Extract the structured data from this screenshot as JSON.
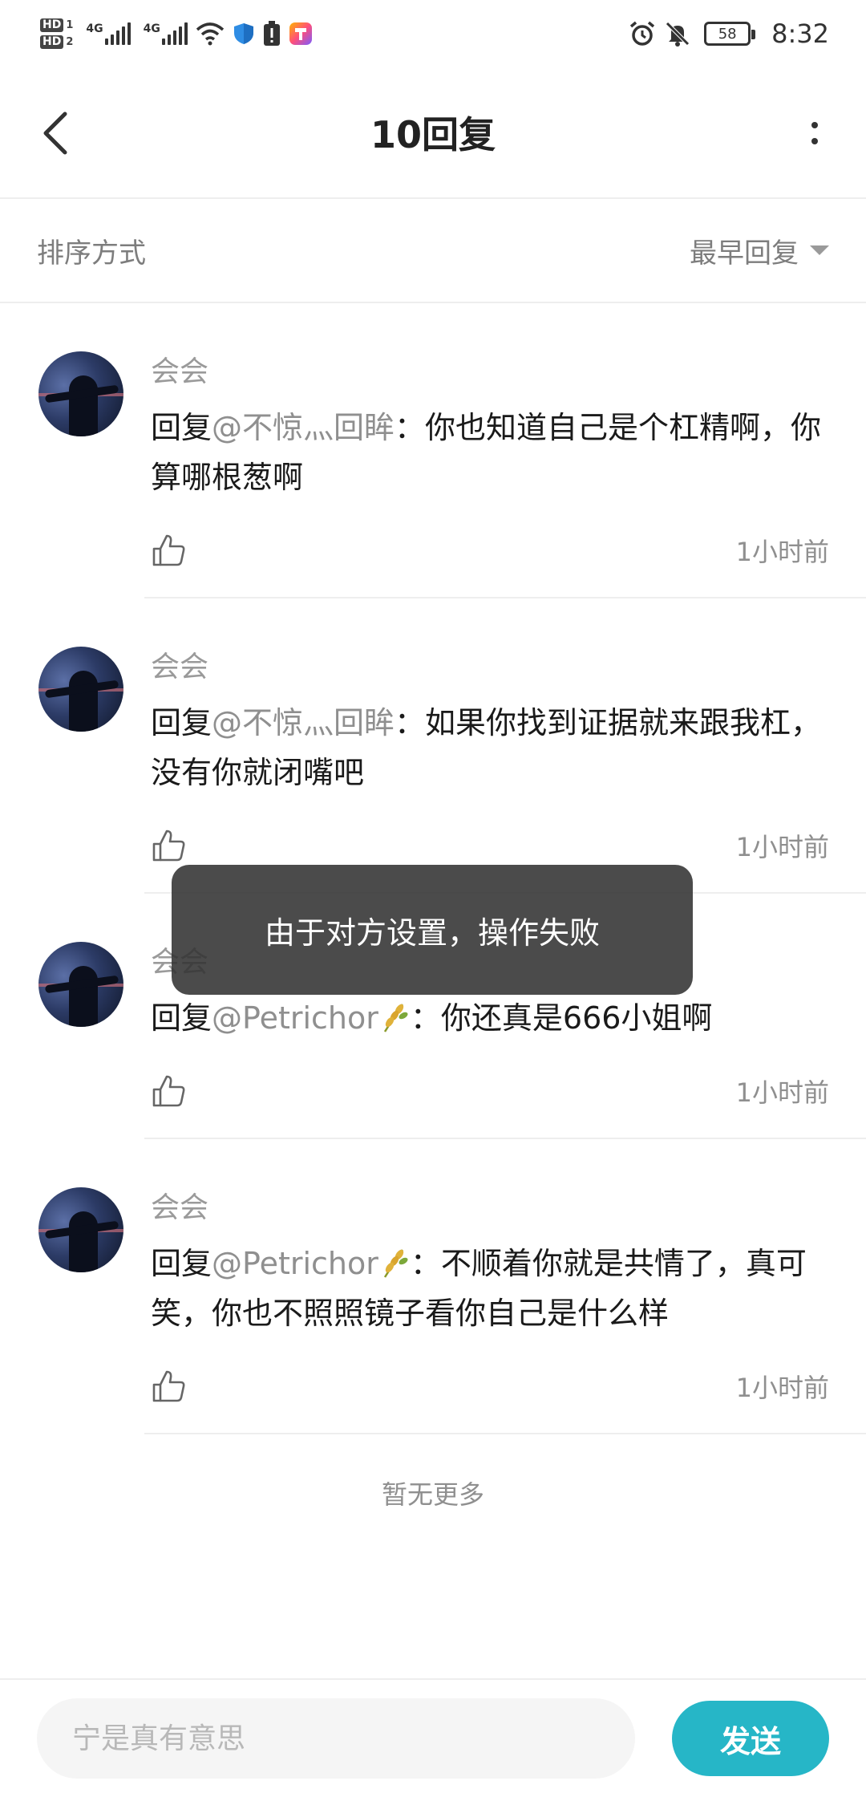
{
  "status_bar": {
    "sim1_tag": "HD",
    "sim1_num": "1",
    "sim2_tag": "HD",
    "sim2_num": "2",
    "network1": "4G",
    "network2": "4G",
    "battery": "58",
    "time": "8:32",
    "icons": [
      "signal-icon",
      "wifi-icon",
      "shield-icon",
      "alert-icon",
      "app-icon",
      "alarm-icon",
      "mute-icon"
    ]
  },
  "header": {
    "title": "10回复"
  },
  "sort": {
    "label": "排序方式",
    "value": "最早回复"
  },
  "replies": [
    {
      "username": "会会",
      "prefix": "回复",
      "mention": "@不惊灬回眸",
      "has_grain": false,
      "separator": "：",
      "text": "你也知道自己是个杠精啊，你算哪根葱啊",
      "time": "1小时前"
    },
    {
      "username": "会会",
      "prefix": "回复",
      "mention": "@不惊灬回眸",
      "has_grain": false,
      "separator": "：",
      "text": "如果你找到证据就来跟我杠，没有你就闭嘴吧",
      "time": "1小时前"
    },
    {
      "username": "会会",
      "prefix": "回复",
      "mention": "@Petrichor",
      "has_grain": true,
      "separator": "：",
      "text": "你还真是666小姐啊",
      "time": "1小时前"
    },
    {
      "username": "会会",
      "prefix": "回复",
      "mention": "@Petrichor",
      "has_grain": true,
      "separator": "：",
      "text": "不顺着你就是共情了，真可笑，你也不照照镜子看你自己是什么样",
      "time": "1小时前"
    }
  ],
  "footer_note": "暂无更多",
  "toast": "由于对方设置，操作失败",
  "input": {
    "placeholder": "宁是真有意思",
    "send_label": "发送"
  },
  "colors": {
    "accent": "#26b6c7",
    "muted_text": "#8f8f8f",
    "toast_bg": "#323232"
  }
}
